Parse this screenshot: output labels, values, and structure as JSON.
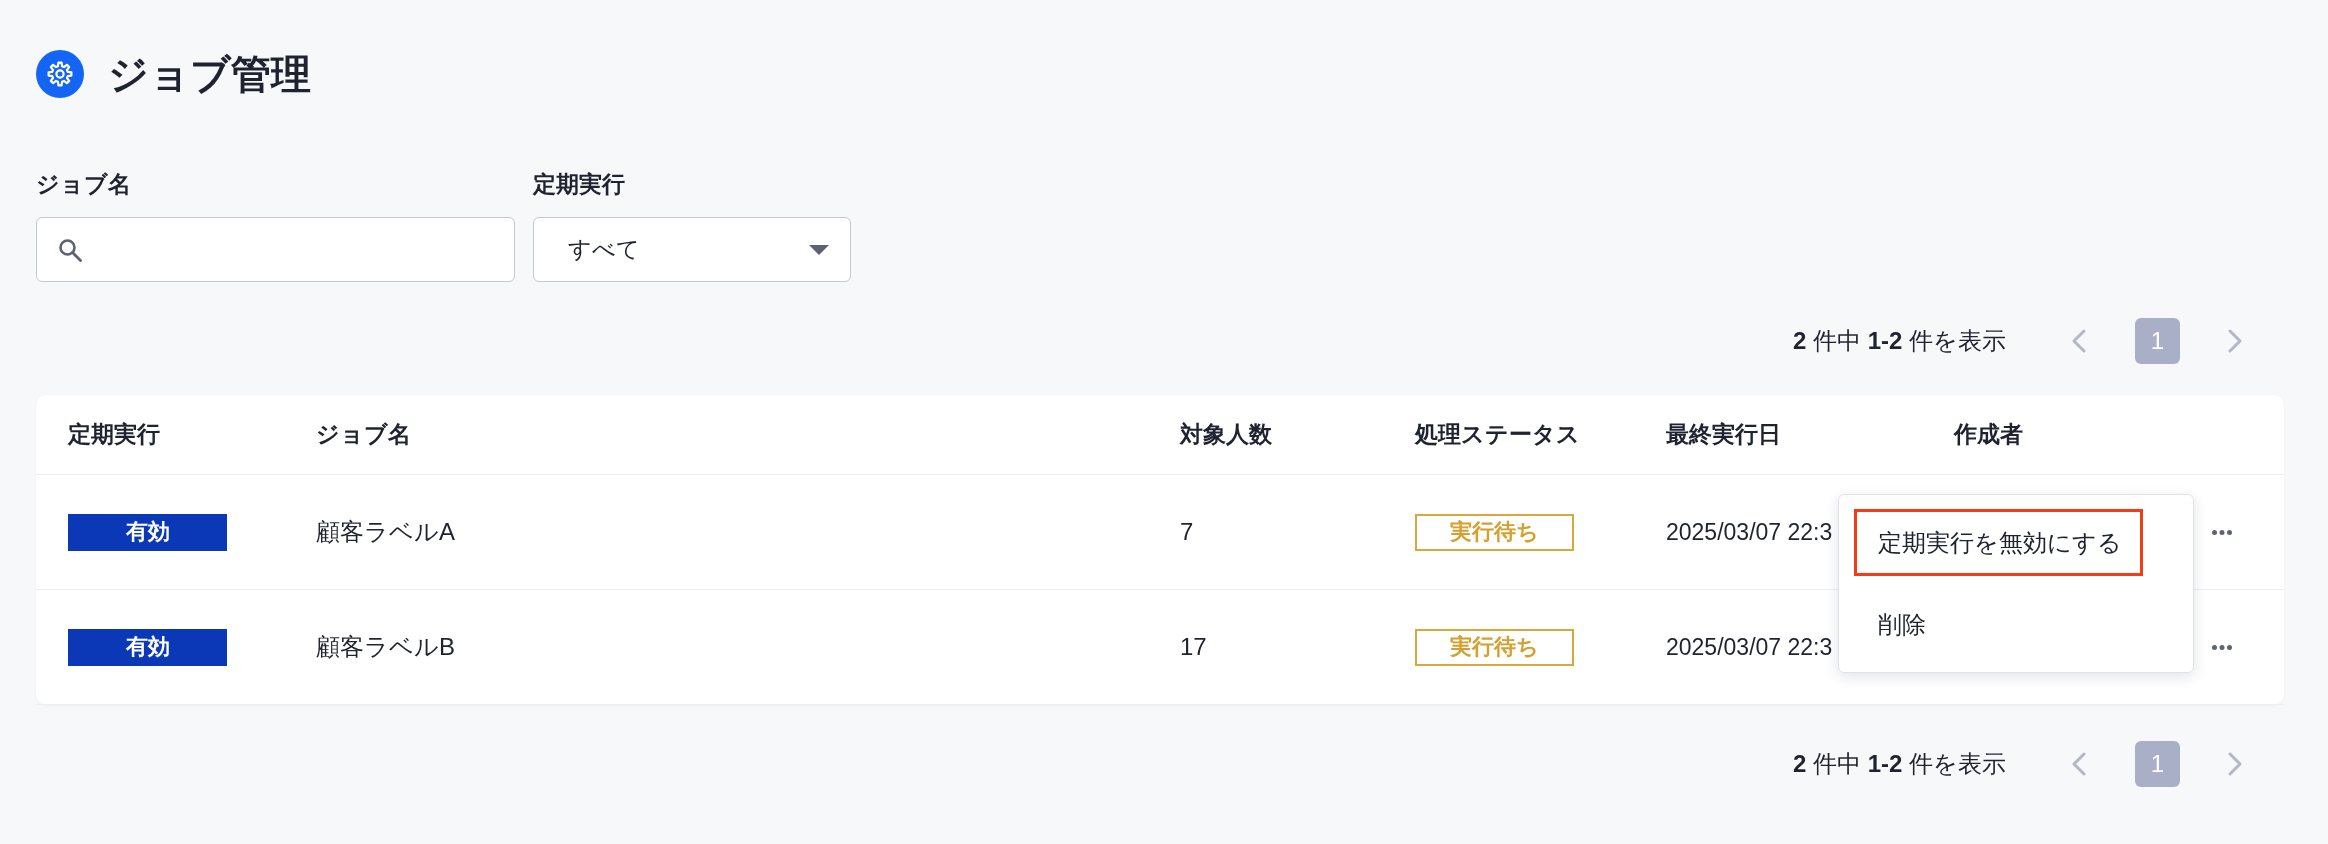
{
  "header": {
    "title": "ジョブ管理"
  },
  "filters": [
    {
      "kind": "search",
      "label": "ジョブ名"
    },
    {
      "kind": "select",
      "label": "定期実行",
      "value": "すべて"
    }
  ],
  "pagination_top": {
    "summary": "**2** 件中 **1-2** 件を表示",
    "pages": [
      {
        "label": "1",
        "selected": true
      }
    ]
  },
  "table": {
    "columns": [
      "定期実行",
      "ジョブ名",
      "対象人数",
      "処理ステータス",
      "最終実行日",
      "作成者"
    ],
    "rows": [
      {
        "schedule": "有効",
        "job_name": "顧客ラベルA",
        "target_count": "7",
        "status": "実行待ち",
        "last_run": "2025/03/07 22:3"
      },
      {
        "schedule": "有効",
        "job_name": "顧客ラベルB",
        "target_count": "17",
        "status": "実行待ち",
        "last_run": "2025/03/07 22:3"
      }
    ]
  },
  "row_menu": {
    "items": [
      {
        "label": "定期実行を無効にする",
        "focused": true
      },
      {
        "label": "削除",
        "focused": false
      }
    ]
  },
  "pagination_bottom": {
    "summary": "**2** 件中 **1-2** 件を表示",
    "pages": [
      {
        "label": "1",
        "selected": true
      }
    ]
  }
}
